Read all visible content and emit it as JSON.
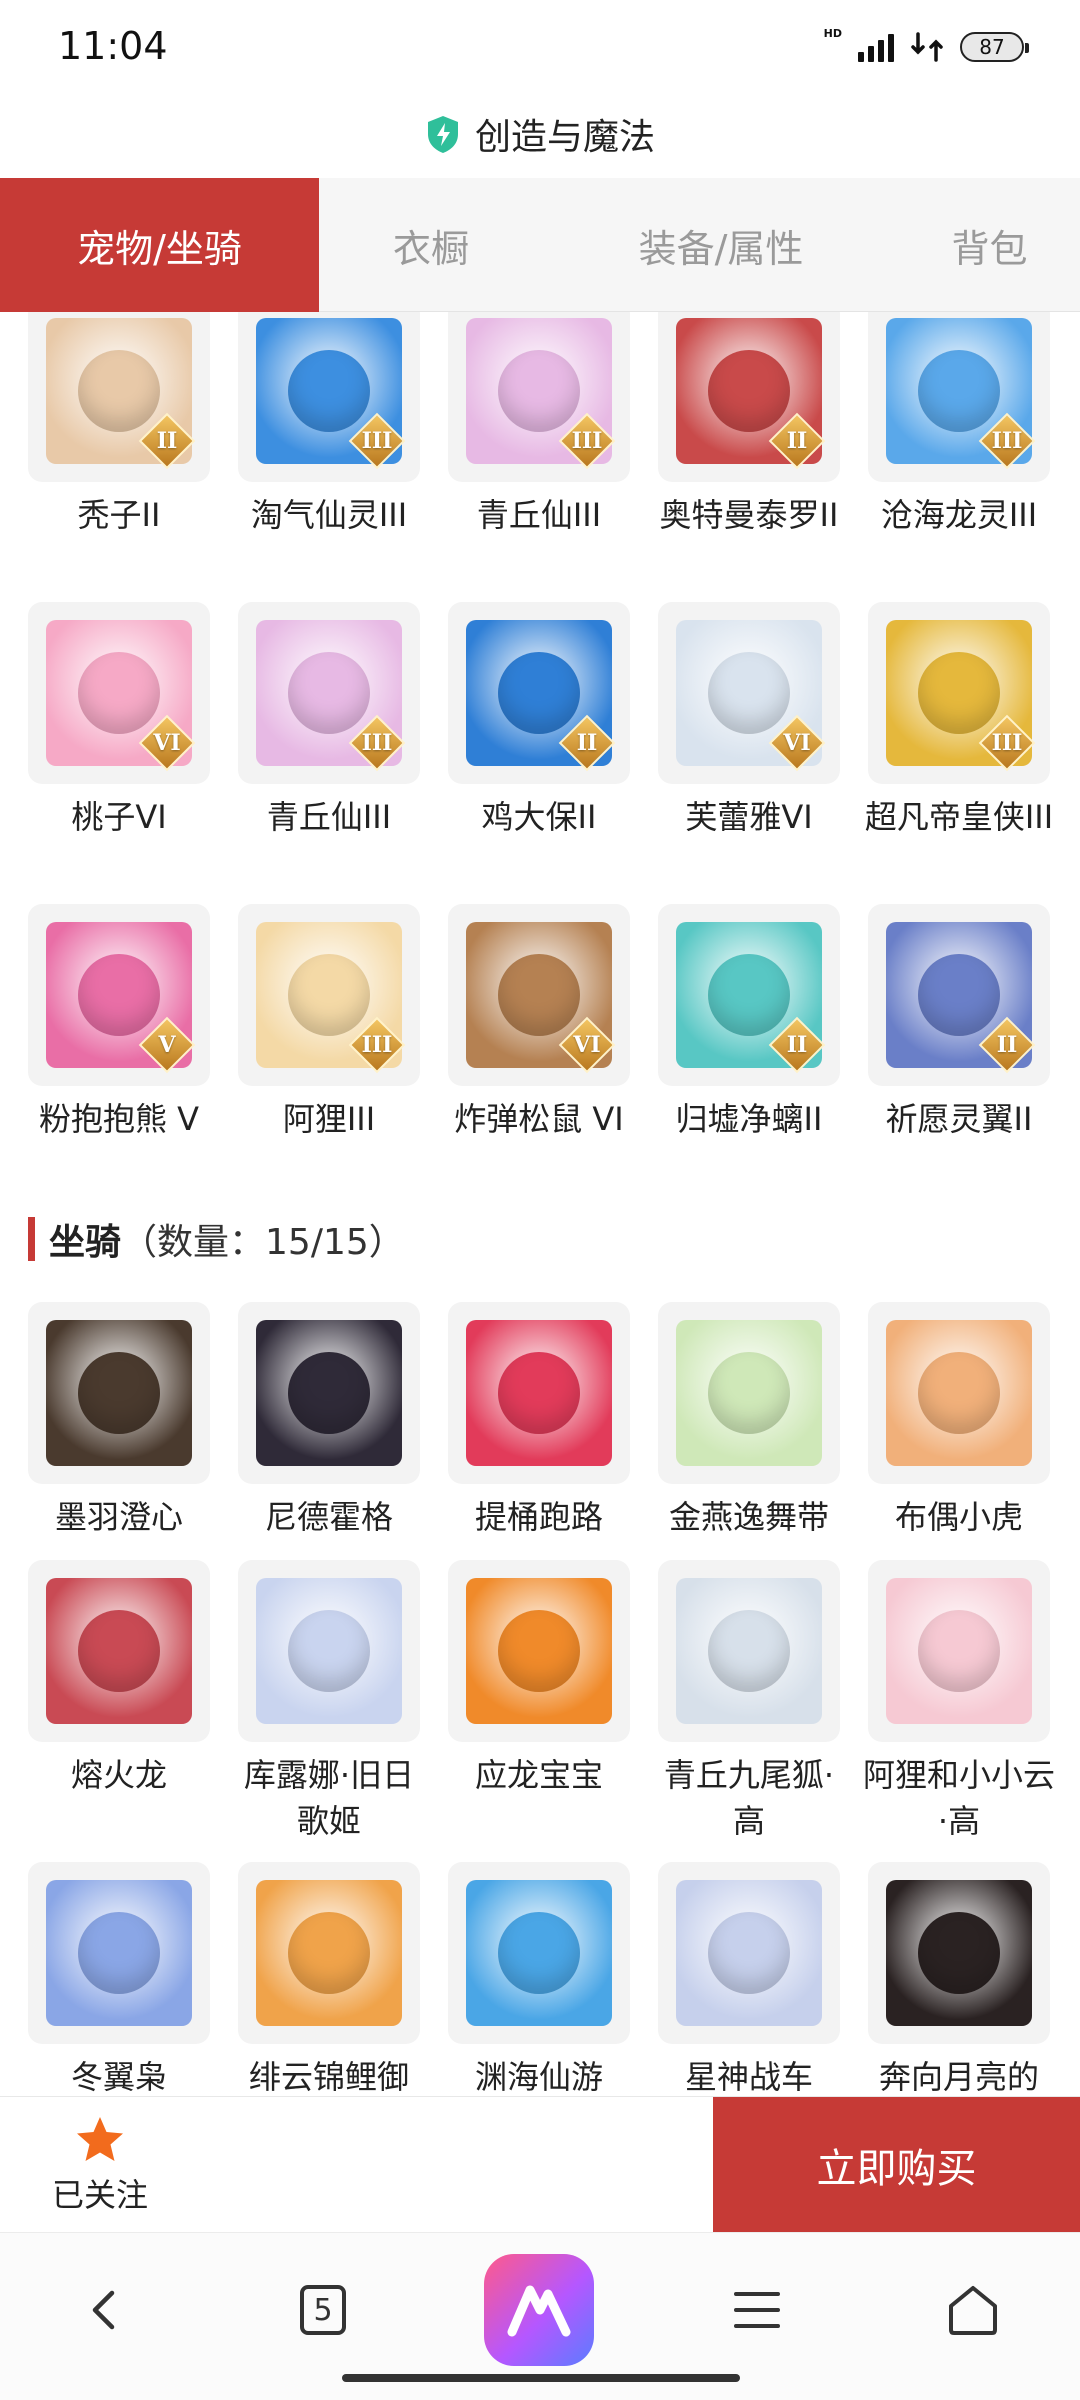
{
  "status_bar": {
    "time": "11:04",
    "hd": "HD",
    "battery": "87"
  },
  "header": {
    "title": "创造与魔法"
  },
  "tabs": [
    {
      "label": "宠物/坐骑",
      "active": true
    },
    {
      "label": "衣橱",
      "active": false
    },
    {
      "label": "装备/属性",
      "active": false
    },
    {
      "label": "背包",
      "active": false
    }
  ],
  "pets": [
    {
      "name": "秃子II",
      "badge": "II",
      "color": "#e8c9a8",
      "icon": "pet-doll-icon"
    },
    {
      "name": "淘气仙灵III",
      "badge": "III",
      "color": "#3d8fe0",
      "icon": "pet-blue-dog-icon"
    },
    {
      "name": "青丘仙III",
      "badge": "III",
      "color": "#e7b9e4",
      "icon": "pet-fox-girl-icon"
    },
    {
      "name": "奥特曼泰罗II",
      "badge": "II",
      "color": "#c94a4a",
      "icon": "pet-hero-icon"
    },
    {
      "name": "沧海龙灵III",
      "badge": "III",
      "color": "#5aa8ea",
      "icon": "pet-dragon-girl-icon"
    },
    {
      "name": "桃子VI",
      "badge": "VI",
      "color": "#f6a9c6",
      "icon": "pet-cat-icon"
    },
    {
      "name": "青丘仙III",
      "badge": "III",
      "color": "#e7b9e4",
      "icon": "pet-fox-girl-icon"
    },
    {
      "name": "鸡大保II",
      "badge": "II",
      "color": "#2f7fd6",
      "icon": "pet-bird-icon"
    },
    {
      "name": "芙蕾雅VI",
      "badge": "VI",
      "color": "#d9e3ee",
      "icon": "pet-goddess-icon"
    },
    {
      "name": "超凡帝皇侠III",
      "badge": "III",
      "color": "#e5b83c",
      "icon": "pet-armor-icon"
    },
    {
      "name": "粉抱抱熊 V",
      "badge": "V",
      "color": "#e96ea6",
      "icon": "pet-bear-icon"
    },
    {
      "name": "阿狸III",
      "badge": "III",
      "color": "#f4d9a6",
      "icon": "pet-ali-icon"
    },
    {
      "name": "炸弹松鼠 VI",
      "badge": "VI",
      "color": "#b58152",
      "icon": "pet-squirrel-icon"
    },
    {
      "name": "归墟净螭II",
      "badge": "II",
      "color": "#58c7c4",
      "icon": "pet-sea-dragon-icon"
    },
    {
      "name": "祈愿灵翼II",
      "badge": "II",
      "color": "#6a7fc8",
      "icon": "pet-phoenix-icon"
    }
  ],
  "mounts_section": {
    "title": "坐骑",
    "count": "（数量：15/15）"
  },
  "mounts": [
    {
      "name": "墨羽澄心",
      "color": "#4a3a2e",
      "icon": "mount-spear-icon"
    },
    {
      "name": "尼德霍格",
      "color": "#2f2a38",
      "icon": "mount-black-dragon-icon"
    },
    {
      "name": "提桶跑路",
      "color": "#e23b5a",
      "icon": "mount-bucket-icon"
    },
    {
      "name": "金燕逸舞带",
      "color": "#cfe8b8",
      "icon": "mount-ribbon-icon"
    },
    {
      "name": "布偶小虎",
      "color": "#f1b07a",
      "icon": "mount-tiger-icon"
    },
    {
      "name": "熔火龙",
      "color": "#c94a54",
      "icon": "mount-fire-dragon-icon"
    },
    {
      "name": "库露娜·旧日歌姬",
      "color": "#c9d4ef",
      "icon": "mount-singer-icon"
    },
    {
      "name": "应龙宝宝",
      "color": "#f08a2a",
      "icon": "mount-baby-dragon-icon"
    },
    {
      "name": "青丘九尾狐·高",
      "color": "#d7e0ea",
      "icon": "mount-nine-tail-fox-icon"
    },
    {
      "name": "阿狸和小小云·高",
      "color": "#f6c9d3",
      "icon": "mount-ali-cloud-icon"
    },
    {
      "name": "冬翼枭",
      "color": "#8aa6e6",
      "icon": "mount-owl-icon"
    },
    {
      "name": "绯云锦鲤御",
      "color": "#f0a34a",
      "icon": "mount-koi-icon"
    },
    {
      "name": "渊海仙游",
      "color": "#4aa6e6",
      "icon": "mount-sea-fairy-icon"
    },
    {
      "name": "星神战车",
      "color": "#c6d0ec",
      "icon": "mount-star-horse-icon"
    },
    {
      "name": "奔向月亮的",
      "color": "#2a2222",
      "icon": "mount-pig-icon"
    }
  ],
  "action_bar": {
    "follow_label": "已关注",
    "buy_label": "立即购买"
  },
  "browser_bar": {
    "tab_count": "5"
  },
  "colors": {
    "accent": "#c63a36",
    "star": "#f26b1d",
    "shield": "#2fbf9a"
  }
}
